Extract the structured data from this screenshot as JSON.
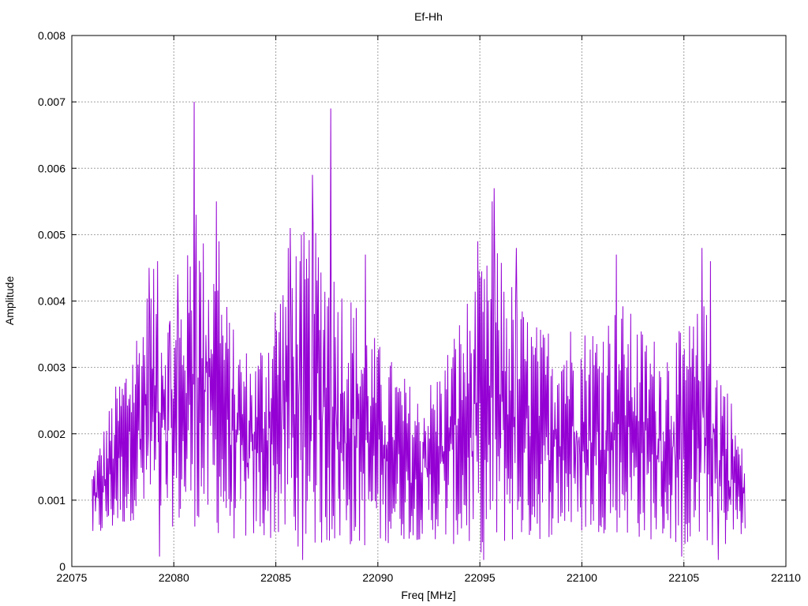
{
  "chart_data": {
    "type": "line",
    "title": "Ef-Hh",
    "xlabel": "Freq [MHz]",
    "ylabel": "Amplitude",
    "xlim": [
      22075,
      22110
    ],
    "ylim": [
      0,
      0.008
    ],
    "x_ticks": [
      "22075",
      "22080",
      "22085",
      "22090",
      "22095",
      "22100",
      "22105",
      "22110"
    ],
    "y_ticks": [
      "0",
      "0.001",
      "0.002",
      "0.003",
      "0.004",
      "0.005",
      "0.006",
      "0.007",
      "0.008"
    ],
    "grid": true,
    "line_color": "#9400d3",
    "series": [
      {
        "x_start": 22076.0,
        "x_end": 22108.0,
        "num_points": 1000,
        "envelope_x": [
          22076.0,
          22077.0,
          22078.0,
          22079.0,
          22080.0,
          22081.0,
          22082.0,
          22083.0,
          22084.0,
          22085.0,
          22086.0,
          22087.0,
          22088.0,
          22089.0,
          22090.0,
          22091.0,
          22092.0,
          22093.0,
          22094.0,
          22095.0,
          22096.0,
          22097.0,
          22098.0,
          22099.0,
          22100.0,
          22101.0,
          22102.0,
          22103.0,
          22104.0,
          22105.0,
          22106.0,
          22107.0,
          22108.0
        ],
        "envelope_max": [
          0.0015,
          0.0026,
          0.0035,
          0.0045,
          0.0038,
          0.0052,
          0.0048,
          0.0035,
          0.0032,
          0.0042,
          0.005,
          0.0052,
          0.0045,
          0.004,
          0.0034,
          0.003,
          0.0026,
          0.003,
          0.0038,
          0.0045,
          0.0048,
          0.004,
          0.0036,
          0.0038,
          0.0036,
          0.0038,
          0.004,
          0.0036,
          0.0034,
          0.0036,
          0.004,
          0.003,
          0.0016
        ],
        "envelope_min": [
          0.0004,
          0.0005,
          0.0007,
          0.0006,
          0.0006,
          0.0006,
          0.0005,
          0.0004,
          0.0004,
          0.0004,
          0.0003,
          0.0003,
          0.0003,
          0.0003,
          0.0003,
          0.0004,
          0.0004,
          0.0004,
          0.0003,
          0.0002,
          0.0003,
          0.0004,
          0.0004,
          0.0005,
          0.0005,
          0.0005,
          0.0005,
          0.0004,
          0.0004,
          0.0003,
          0.0003,
          0.0003,
          0.0005
        ],
        "peaks": [
          {
            "x": 22078.8,
            "y": 0.0045
          },
          {
            "x": 22079.2,
            "y": 0.0046
          },
          {
            "x": 22079.8,
            "y": 0.0037
          },
          {
            "x": 22080.2,
            "y": 0.0044
          },
          {
            "x": 22081.0,
            "y": 0.007
          },
          {
            "x": 22081.1,
            "y": 0.0053
          },
          {
            "x": 22082.1,
            "y": 0.0055
          },
          {
            "x": 22082.2,
            "y": 0.0049
          },
          {
            "x": 22085.6,
            "y": 0.0048
          },
          {
            "x": 22085.7,
            "y": 0.0051
          },
          {
            "x": 22086.8,
            "y": 0.0059
          },
          {
            "x": 22087.7,
            "y": 0.0069
          },
          {
            "x": 22089.4,
            "y": 0.0047
          },
          {
            "x": 22094.9,
            "y": 0.0049
          },
          {
            "x": 22095.7,
            "y": 0.0057
          },
          {
            "x": 22095.6,
            "y": 0.0055
          },
          {
            "x": 22096.8,
            "y": 0.0048
          },
          {
            "x": 22101.7,
            "y": 0.0047
          },
          {
            "x": 22105.9,
            "y": 0.0048
          },
          {
            "x": 22106.3,
            "y": 0.0046
          }
        ],
        "dips": [
          {
            "x": 22079.3,
            "y": 0.00015
          },
          {
            "x": 22086.3,
            "y": 0.0001
          },
          {
            "x": 22095.2,
            "y": 0.0001
          },
          {
            "x": 22104.9,
            "y": 0.00015
          },
          {
            "x": 22106.7,
            "y": 0.0001
          }
        ]
      }
    ]
  }
}
